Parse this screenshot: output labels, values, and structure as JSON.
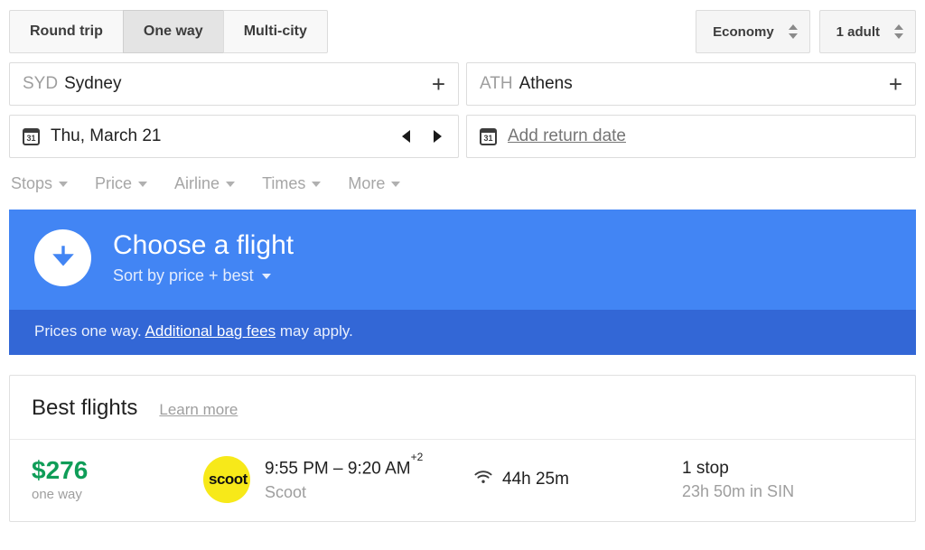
{
  "trip_tabs": [
    {
      "label": "Round trip",
      "selected": false
    },
    {
      "label": "One way",
      "selected": true
    },
    {
      "label": "Multi-city",
      "selected": false
    }
  ],
  "controls": {
    "cabin_class": "Economy",
    "passengers": "1 adult"
  },
  "origin": {
    "code": "SYD",
    "city": "Sydney",
    "add_label": "+"
  },
  "destination": {
    "code": "ATH",
    "city": "Athens",
    "add_label": "+"
  },
  "depart": {
    "icon": "calendar-icon",
    "icon_day": "31",
    "date": "Thu, March 21"
  },
  "return": {
    "icon": "calendar-icon",
    "icon_day": "31",
    "label": "Add return date"
  },
  "filters": [
    {
      "label": "Stops"
    },
    {
      "label": "Price"
    },
    {
      "label": "Airline"
    },
    {
      "label": "Times"
    },
    {
      "label": "More"
    }
  ],
  "banner": {
    "icon": "download-arrow-icon",
    "title": "Choose a flight",
    "sort_label": "Sort by price + best",
    "note_prefix": "Prices one way. ",
    "note_link": "Additional bag fees",
    "note_suffix": " may apply.",
    "bg_color": "#4285f4",
    "foot_color": "#3367d6"
  },
  "results": {
    "section_title": "Best flights",
    "learn_more": "Learn more",
    "flights": [
      {
        "price": "$276",
        "price_sub": "one way",
        "price_color": "#0f9d58",
        "airline_logo_text": "scoot",
        "airline_logo_color": "#f7e919",
        "times": "9:55 PM – 9:20 AM",
        "day_offset": "+2",
        "carrier": "Scoot",
        "amenity_icon": "wifi-icon",
        "duration": "44h 25m",
        "stops": "1 stop",
        "layover": "23h 50m in SIN"
      }
    ]
  }
}
